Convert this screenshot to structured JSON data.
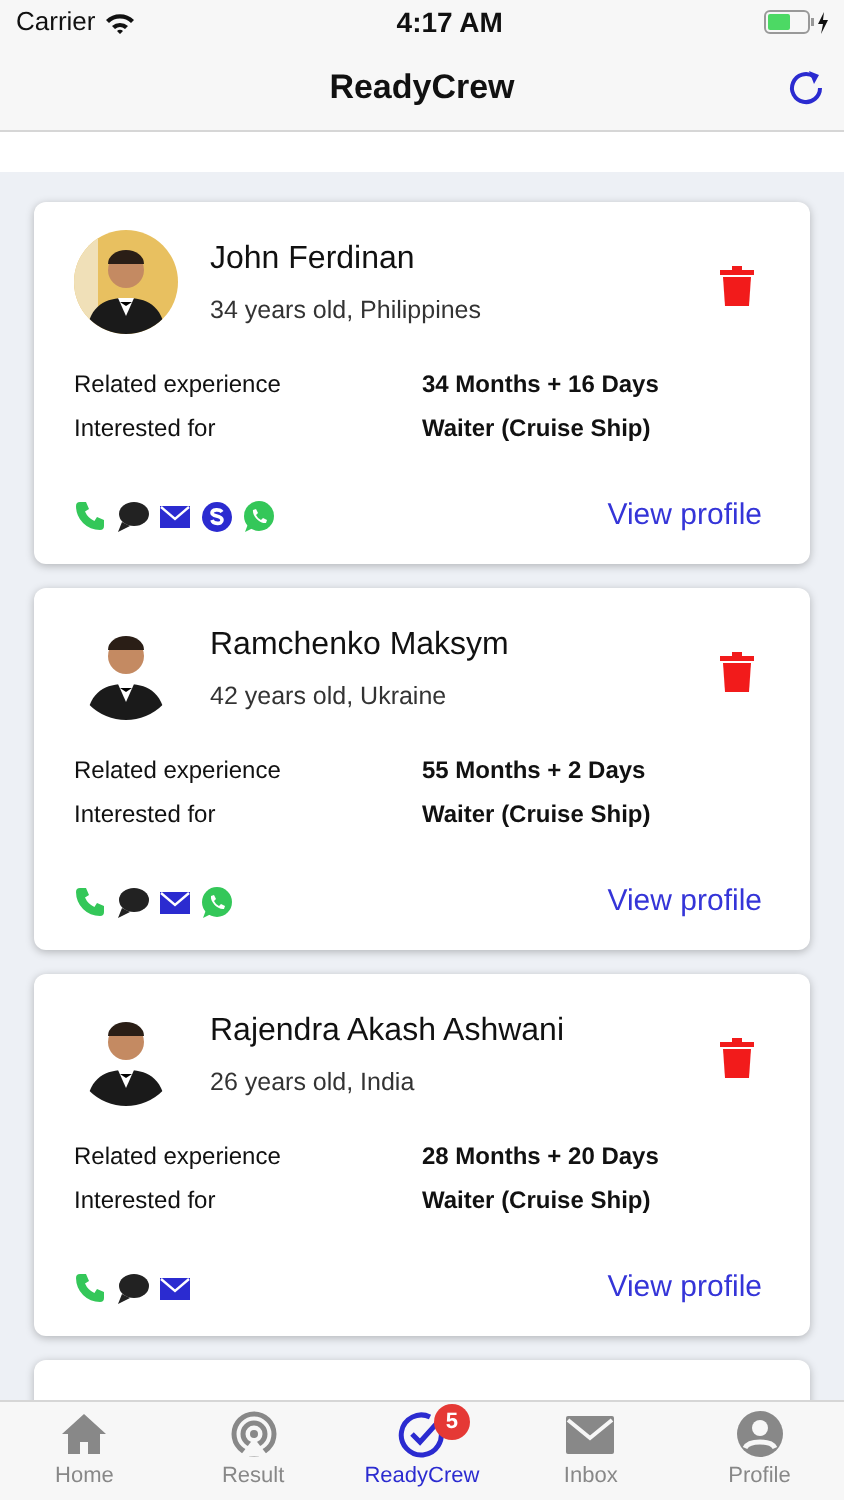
{
  "status_bar": {
    "carrier": "Carrier",
    "time": "4:17 AM",
    "battery": {
      "level": 0.6,
      "charging": true
    }
  },
  "nav_bar": {
    "title": "ReadyCrew"
  },
  "candidates": [
    {
      "name": "John Ferdinan",
      "subtitle": "34 years old, Philippines",
      "picture": {
        "kind": "picture"
      },
      "details": [
        {
          "label": "Related experience",
          "value": "34 Months + 16 Days"
        },
        {
          "label": "Interested for",
          "value": "Waiter (Cruise Ship)"
        }
      ],
      "contacts": [
        {
          "kind": "phone"
        },
        {
          "kind": "chat"
        },
        {
          "kind": "mail"
        },
        {
          "kind": "skype"
        },
        {
          "kind": "whatsapp"
        }
      ],
      "link": "View profile"
    },
    {
      "name": "Ramchenko Maksym",
      "subtitle": "42 years old, Ukraine",
      "picture": {
        "kind": "picture"
      },
      "details": [
        {
          "label": "Related experience",
          "value": "55 Months + 2 Days"
        },
        {
          "label": "Interested for",
          "value": "Waiter (Cruise Ship)"
        }
      ],
      "contacts": [
        {
          "kind": "phone"
        },
        {
          "kind": "chat"
        },
        {
          "kind": "mail"
        },
        {
          "kind": "whatsapp"
        }
      ],
      "link": "View profile"
    },
    {
      "name": "Rajendra Akash Ashwani",
      "subtitle": "26 years old, India",
      "picture": {
        "kind": "picture"
      },
      "details": [
        {
          "label": "Related experience",
          "value": "28 Months + 20 Days"
        },
        {
          "label": "Interested for",
          "value": "Waiter (Cruise Ship)"
        }
      ],
      "contacts": [
        {
          "kind": "phone"
        },
        {
          "kind": "chat"
        },
        {
          "kind": "mail"
        }
      ],
      "link": "View profile"
    }
  ],
  "tab_bar": [
    {
      "label": "Home",
      "selected": false
    },
    {
      "label": "Result",
      "selected": false
    },
    {
      "label": "ReadyCrew",
      "selected": true,
      "badge": "5"
    },
    {
      "label": "Inbox",
      "selected": false
    },
    {
      "label": "Profile",
      "selected": false
    }
  ]
}
